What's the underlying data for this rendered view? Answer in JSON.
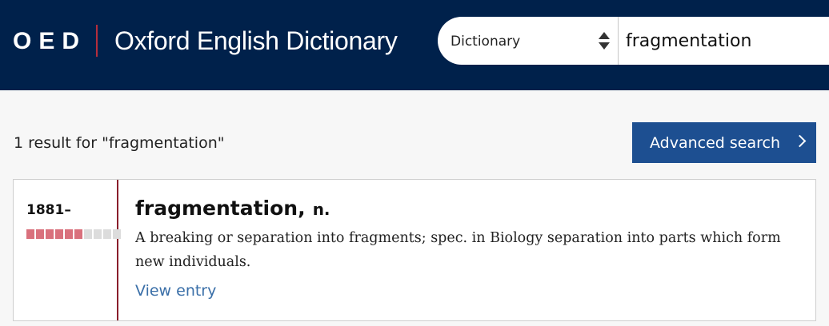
{
  "header": {
    "logo_abbrev": "OED",
    "logo_title": "Oxford English Dictionary",
    "search": {
      "select_value": "Dictionary",
      "query": "fragmentation"
    }
  },
  "results": {
    "count_text": "1 result for \"fragmentation\"",
    "advanced_search_label": "Advanced search",
    "items": [
      {
        "date": "1881–",
        "frequency": {
          "filled": 6,
          "total": 10
        },
        "headword": "fragmentation,",
        "pos": "n.",
        "definition": "A breaking or separation into fragments; spec. in Biology separation into parts which form new individuals.",
        "link_label": "View entry"
      }
    ]
  },
  "colors": {
    "header_bg": "#00214b",
    "accent_red": "#b52e3c",
    "button_blue": "#1d4f91",
    "link_blue": "#3a6fa8",
    "freq_filled": "#d9707c",
    "freq_empty": "#dcdcdc"
  }
}
